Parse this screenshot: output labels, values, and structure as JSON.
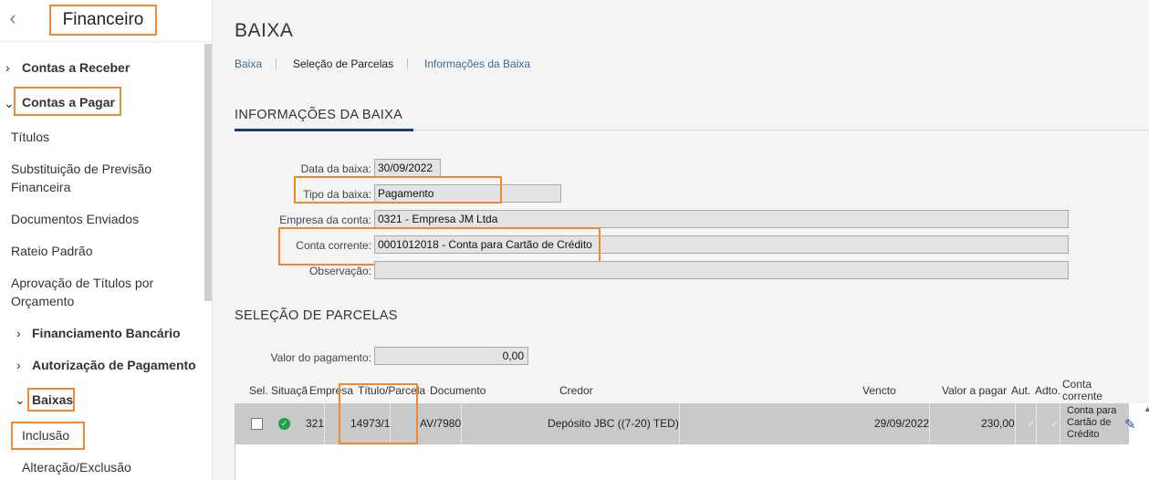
{
  "sidebar": {
    "title": "Financeiro",
    "back_icon": "chevron-left-icon",
    "items": [
      {
        "label": "Contas a Receber"
      },
      {
        "label": "Contas a Pagar"
      },
      {
        "label": "Títulos"
      },
      {
        "label": "Substituição de Previsão"
      },
      {
        "label": "Financeira"
      },
      {
        "label": "Documentos Enviados"
      },
      {
        "label": "Rateio Padrão"
      },
      {
        "label": "Aprovação de Títulos por"
      },
      {
        "label": "Orçamento"
      },
      {
        "label": "Financiamento Bancário"
      },
      {
        "label": "Autorização de Pagamento"
      },
      {
        "label": "Baixas"
      },
      {
        "label": "Inclusão"
      },
      {
        "label": "Alteração/Exclusão"
      }
    ]
  },
  "main": {
    "title": "BAIXA",
    "tabs": [
      {
        "label": "Baixa"
      },
      {
        "label": "Seleção de Parcelas"
      },
      {
        "label": "Informações da Baixa"
      }
    ],
    "info_section": {
      "title": "INFORMAÇÕES DA BAIXA",
      "fields": [
        {
          "label": "Data da baixa:",
          "value": "30/09/2022"
        },
        {
          "label": "Tipo da baixa:",
          "value": "Pagamento"
        },
        {
          "label": "Empresa da conta:",
          "value": "0321 - Empresa JM Ltda"
        },
        {
          "label": "Conta corrente:",
          "value": "0001012018 - Conta para Cartão de Crédito"
        },
        {
          "label": "Observação:",
          "value": ""
        }
      ]
    },
    "selection_section": {
      "title": "SELEÇÃO DE PARCELAS",
      "payment_label": "Valor do pagamento:",
      "payment_value": "0,00",
      "columns": [
        "Sel.",
        "Situaçã",
        "Empresa",
        "Título/Parcela",
        "Documento",
        "Credor",
        "Vencto",
        "Valor a pagar",
        "Aut.",
        "Adto.",
        "Conta",
        "corrente"
      ],
      "row": {
        "empresa": "321",
        "titulo": "14973/1",
        "documento": "AV/7980",
        "credor": "Depósito JBC ((7-20) TED)",
        "vencto": "29/09/2022",
        "valor": "230,00",
        "conta_line1": "Conta para",
        "conta_line2": "Cartão de",
        "conta_line3": "Crédito",
        "status_color": "#1e9e4a"
      }
    }
  },
  "colors": {
    "highlight": "#ee8a2e",
    "accent": "#1f3c6e",
    "link": "#3a6a95"
  }
}
